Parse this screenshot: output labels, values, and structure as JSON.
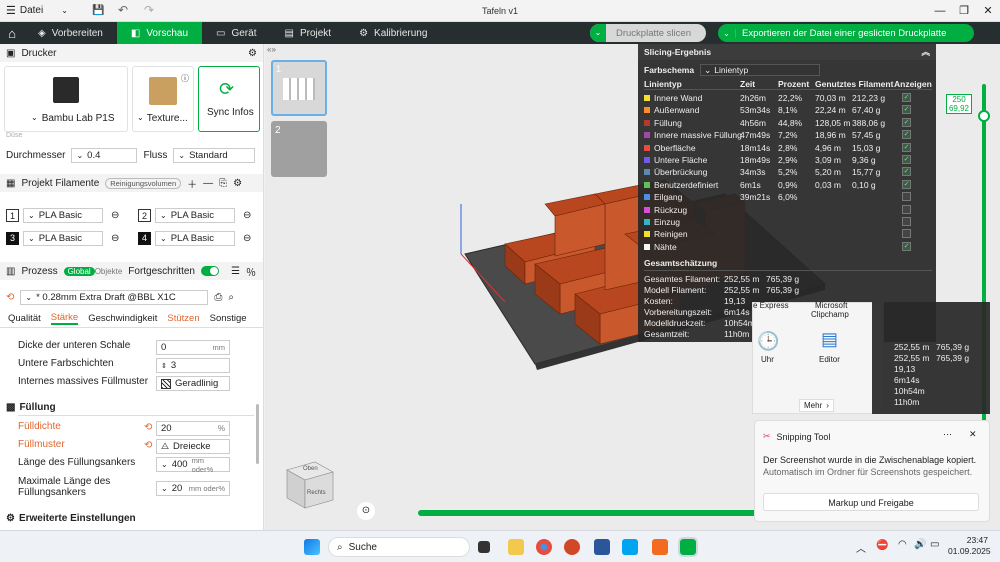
{
  "titlebar": {
    "file_menu": "Datei",
    "title": "Tafeln v1"
  },
  "tabs": [
    {
      "label": "Vorbereiten"
    },
    {
      "label": "Vorschau"
    },
    {
      "label": "Gerät"
    },
    {
      "label": "Projekt"
    },
    {
      "label": "Kalibrierung"
    }
  ],
  "actions": {
    "slice": "Druckplatte slicen",
    "export": "Exportieren der Datei einer geslicten Druckplatte"
  },
  "printer": {
    "section": "Drucker",
    "name": "Bambu Lab P1S",
    "plate": "Texture...",
    "sync": "Sync Infos",
    "nozzle_hint": "Düse",
    "diameter_label": "Durchmesser",
    "diameter_value": "0.4",
    "flow_label": "Fluss",
    "flow_value": "Standard"
  },
  "filaments": {
    "section": "Projekt Filamente",
    "volume_btn": "Reinigungsvolumen",
    "items": [
      {
        "num": "1",
        "name": "PLA Basic"
      },
      {
        "num": "2",
        "name": "PLA Basic"
      },
      {
        "num": "3",
        "name": "PLA Basic"
      },
      {
        "num": "4",
        "name": "PLA Basic"
      }
    ]
  },
  "process": {
    "section": "Prozess",
    "global": "Global",
    "objects": "Objekte",
    "advanced": "Fortgeschritten",
    "profile": "* 0.28mm Extra Draft @BBL X1C",
    "subtabs": [
      "Qualität",
      "Stärke",
      "Geschwindigkeit",
      "Stützen",
      "Sonstige"
    ],
    "bottom_shell_label": "Dicke der unteren Schale",
    "bottom_shell_value": "0",
    "bottom_shell_unit": "mm",
    "bottom_layers_label": "Untere Farbschichten",
    "bottom_layers_value": "3",
    "internal_solid_label": "Internes massives Füllmuster",
    "internal_solid_value": "Geradlinig",
    "infill_section": "Füllung",
    "infill_density_label": "Fülldichte",
    "infill_density_value": "20",
    "infill_density_unit": "%",
    "infill_pattern_label": "Füllmuster",
    "infill_pattern_value": "Dreiecke",
    "anchor_label": "Länge des Füllungsankers",
    "anchor_value": "400",
    "anchor_unit": "mm oder%",
    "max_anchor_label1": "Maximale Länge des",
    "max_anchor_label2": "Füllungsankers",
    "max_anchor_value": "20",
    "max_anchor_unit": "mm oder%",
    "advanced_section": "Erweiterte Einstellungen"
  },
  "plates": [
    {
      "num": "1"
    },
    {
      "num": "2"
    }
  ],
  "layer_slider": {
    "top": "250",
    "height": "69,92"
  },
  "viewcube": {
    "top": "Oben",
    "right": "Rechts"
  },
  "slicing": {
    "title": "Slicing-Ergebnis",
    "scheme_label": "Farbschema",
    "scheme_value": "Linientyp",
    "headers": [
      "Linientyp",
      "Zeit",
      "Prozent",
      "Genutztes Filament",
      "Anzeigen"
    ],
    "rows": [
      {
        "name": "Innere Wand",
        "time": "2h26m",
        "pct": "22,2%",
        "len": "70,03 m",
        "g": "212,23 g",
        "color": "#f0e030",
        "checked": true
      },
      {
        "name": "Außenwand",
        "time": "53m34s",
        "pct": "8,1%",
        "len": "22,24 m",
        "g": "67,40 g",
        "color": "#ff8c2a",
        "checked": true
      },
      {
        "name": "Füllung",
        "time": "4h56m",
        "pct": "44,8%",
        "len": "128,05 m",
        "g": "388,06 g",
        "color": "#b03a2e",
        "checked": true
      },
      {
        "name": "Innere massive Füllung",
        "time": "47m49s",
        "pct": "7,2%",
        "len": "18,96 m",
        "g": "57,45 g",
        "color": "#a349a4",
        "checked": true
      },
      {
        "name": "Oberfläche",
        "time": "18m14s",
        "pct": "2,8%",
        "len": "4,96 m",
        "g": "15,03 g",
        "color": "#e74c3c",
        "checked": true
      },
      {
        "name": "Untere Fläche",
        "time": "18m49s",
        "pct": "2,9%",
        "len": "3,09 m",
        "g": "9,36 g",
        "color": "#6c5ce7",
        "checked": true
      },
      {
        "name": "Überbrückung",
        "time": "34m3s",
        "pct": "5,2%",
        "len": "5,20 m",
        "g": "15,77 g",
        "color": "#5d8aa8",
        "checked": true
      },
      {
        "name": "Benutzerdefiniert",
        "time": "6m1s",
        "pct": "0,9%",
        "len": "0,03 m",
        "g": "0,10 g",
        "color": "#5fbf5f",
        "checked": true
      },
      {
        "name": "Eilgang",
        "time": "39m21s",
        "pct": "6,0%",
        "len": "",
        "g": "",
        "color": "#4a90e2",
        "checked": false
      },
      {
        "name": "Rückzug",
        "time": "",
        "pct": "",
        "len": "",
        "g": "",
        "color": "#d94dd9",
        "checked": false
      },
      {
        "name": "Einzug",
        "time": "",
        "pct": "",
        "len": "",
        "g": "",
        "color": "#33b5c8",
        "checked": false
      },
      {
        "name": "Reinigen",
        "time": "",
        "pct": "",
        "len": "",
        "g": "",
        "color": "#f0e030",
        "checked": false
      },
      {
        "name": "Nähte",
        "time": "",
        "pct": "",
        "len": "",
        "g": "",
        "color": "#f5f5f5",
        "checked": true
      }
    ],
    "estimate_title": "Gesamtschätzung",
    "estimates": [
      {
        "label": "Gesamtes Filament:",
        "v1": "252,55 m",
        "v2": "765,39 g"
      },
      {
        "label": "Modell Filament:",
        "v1": "252,55 m",
        "v2": "765,39 g"
      },
      {
        "label": "Kosten:",
        "v1": "19,13",
        "v2": ""
      },
      {
        "label": "Vorbereitungszeit:",
        "v1": "6m14s",
        "v2": ""
      },
      {
        "label": "Modelldruckzeit:",
        "v1": "10h54m",
        "v2": ""
      },
      {
        "label": "Gesamtzeit:",
        "v1": "11h0m",
        "v2": ""
      }
    ]
  },
  "overlay2": {
    "rows": [
      {
        "v1": "252,55 m",
        "v2": "765,39 g"
      },
      {
        "v1": "252,55 m",
        "v2": "765,39 g"
      },
      {
        "v1": "19,13",
        "v2": ""
      },
      {
        "v1": "6m14s",
        "v2": ""
      },
      {
        "v1": "10h54m",
        "v2": ""
      },
      {
        "v1": "11h0m",
        "v2": ""
      }
    ]
  },
  "startmenu": {
    "app_top1": "e Express",
    "app_top2": "Microsoft",
    "app_top3": "Clipchamp",
    "app1": "Uhr",
    "app2": "Editor",
    "more": "Mehr"
  },
  "toast": {
    "app": "Snipping Tool",
    "line1": "Der Screenshot wurde in die Zwischenablage kopiert.",
    "line2": "Automatisch im Ordner für Screenshots gespeichert.",
    "button": "Markup und Freigabe"
  },
  "taskbar": {
    "search": "Suche",
    "time": "23:47",
    "date": "01.09.2025"
  },
  "colors": {
    "accent": "#00ae42",
    "dark_toolbar": "#262e30",
    "model": "#b8461e"
  }
}
